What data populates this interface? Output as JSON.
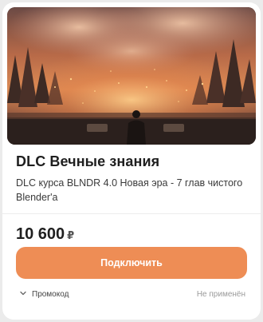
{
  "product": {
    "title": "DLC Вечные знания",
    "description": "DLC курса BLNDR 4.0 Новая эра - 7 глав чистого Blender'а",
    "image_icon": "hero-illustration"
  },
  "price": {
    "amount": "10 600",
    "currency": "₽"
  },
  "actions": {
    "connect_label": "Подключить"
  },
  "promo": {
    "label": "Промокод",
    "status": "Не применён",
    "icon": "chevron-down-icon"
  },
  "colors": {
    "accent": "#ee8d55",
    "text": "#1f1f1f",
    "muted": "#9a9a9a"
  }
}
